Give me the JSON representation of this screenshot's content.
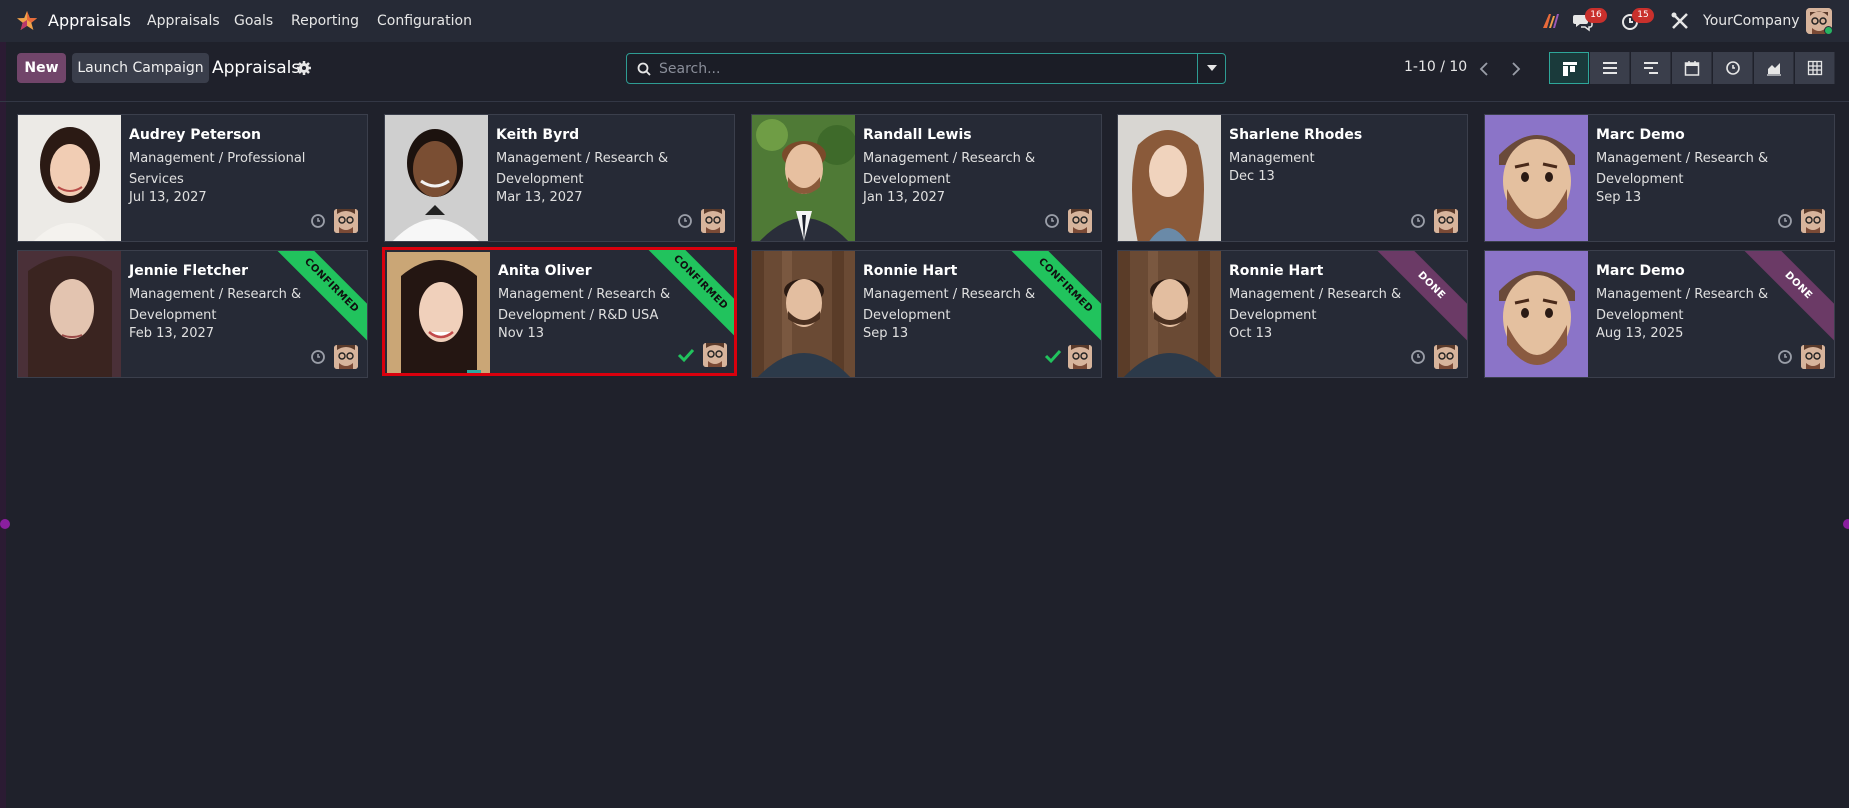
{
  "app": {
    "name": "Appraisals",
    "menu": [
      "Appraisals",
      "Goals",
      "Reporting",
      "Configuration"
    ],
    "messages_badge": "16",
    "activities_badge": "15",
    "company": "YourCompany"
  },
  "control_panel": {
    "new_label": "New",
    "launch_label": "Launch Campaign",
    "title": "Appraisals",
    "search_placeholder": "Search...",
    "pager": "1-10 / 10"
  },
  "cards": [
    {
      "name": "Audrey Peterson",
      "dept": "Management / Professional Services",
      "date": "Jul 13, 2027",
      "status": ""
    },
    {
      "name": "Keith Byrd",
      "dept": "Management / Research & Development",
      "date": "Mar 13, 2027",
      "status": ""
    },
    {
      "name": "Randall Lewis",
      "dept": "Management / Research & Development",
      "date": "Jan 13, 2027",
      "status": ""
    },
    {
      "name": "Sharlene Rhodes",
      "dept": "Management",
      "date": "Dec 13",
      "status": ""
    },
    {
      "name": "Marc Demo",
      "dept": "Management / Research & Development",
      "date": "Sep 13",
      "status": ""
    },
    {
      "name": "Jennie Fletcher",
      "dept": "Management / Research & Development",
      "date": "Feb 13, 2027",
      "status": "CONFIRMED"
    },
    {
      "name": "Anita Oliver",
      "dept": "Management / Research & Development / R&D USA",
      "date": "Nov 13",
      "status": "CONFIRMED"
    },
    {
      "name": "Ronnie Hart",
      "dept": "Management / Research & Development",
      "date": "Sep 13",
      "status": "CONFIRMED"
    },
    {
      "name": "Ronnie Hart",
      "dept": "Management / Research & Development",
      "date": "Oct 13",
      "status": "DONE"
    },
    {
      "name": "Marc Demo",
      "dept": "Management / Research & Development",
      "date": "Aug 13, 2025",
      "status": "DONE"
    }
  ],
  "colors": {
    "background": "#1f212b",
    "navbar": "#262a36",
    "primary": "#71456a",
    "confirmed": "#21c35d",
    "done": "#6b3a66",
    "selection": "#d9000d"
  }
}
